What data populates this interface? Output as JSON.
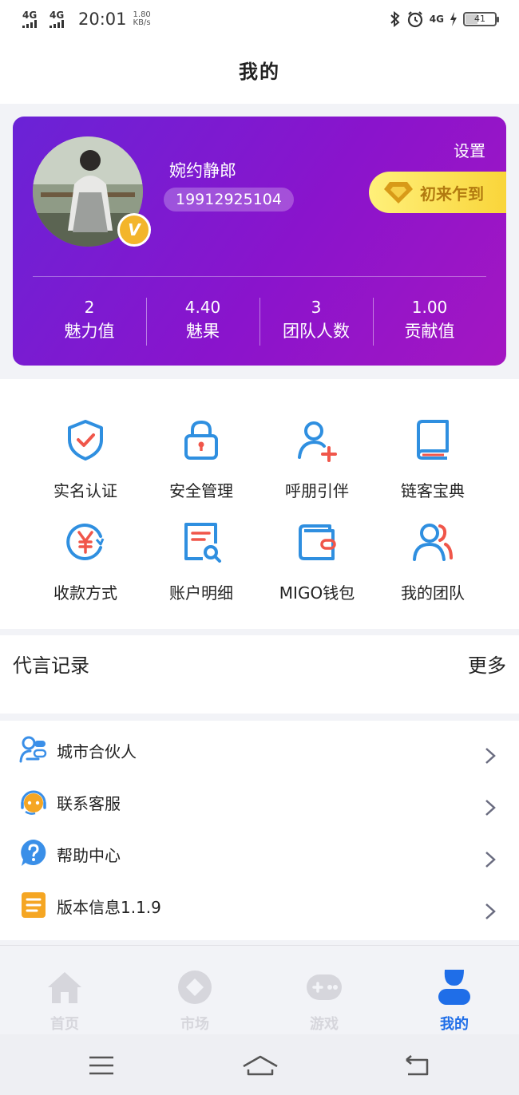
{
  "status_bar": {
    "signal1": "4G",
    "signal2": "4G",
    "time": "20:01",
    "speed_value": "1.80",
    "speed_unit": "KB/s",
    "network": "4G",
    "battery": "41"
  },
  "header": {
    "title": "我的"
  },
  "profile": {
    "username": "婉约静郎",
    "phone": "19912925104",
    "settings_label": "设置",
    "checkin_label": "初来乍到",
    "vip_badge": "V",
    "stats": [
      {
        "value": "2",
        "label": "魅力值"
      },
      {
        "value": "4.40",
        "label": "魅果"
      },
      {
        "value": "3",
        "label": "团队人数"
      },
      {
        "value": "1.00",
        "label": "贡献值"
      }
    ]
  },
  "grid_menu": [
    {
      "label": "实名认证",
      "icon": "shield-check-icon"
    },
    {
      "label": "安全管理",
      "icon": "lock-icon"
    },
    {
      "label": "呼朋引伴",
      "icon": "add-user-icon"
    },
    {
      "label": "链客宝典",
      "icon": "book-icon"
    },
    {
      "label": "收款方式",
      "icon": "yen-icon"
    },
    {
      "label": "账户明细",
      "icon": "document-search-icon"
    },
    {
      "label": "MIGO钱包",
      "icon": "wallet-icon"
    },
    {
      "label": "我的团队",
      "icon": "team-icon"
    }
  ],
  "records": {
    "title": "代言记录",
    "more": "更多"
  },
  "list": [
    {
      "label": "城市合伙人",
      "icon": "partner-icon"
    },
    {
      "label": "联系客服",
      "icon": "customer-service-icon"
    },
    {
      "label": "帮助中心",
      "icon": "help-icon"
    },
    {
      "label": "版本信息1.1.9",
      "icon": "version-icon"
    }
  ],
  "tabs": [
    {
      "label": "首页",
      "icon": "home-icon"
    },
    {
      "label": "市场",
      "icon": "market-icon"
    },
    {
      "label": "游戏",
      "icon": "game-icon"
    },
    {
      "label": "我的",
      "icon": "profile-icon",
      "active": true
    }
  ],
  "colors": {
    "accent_blue": "#2f8fe0",
    "accent_red": "#f0564a",
    "card_gradient_start": "#6a23d6",
    "card_gradient_end": "#a416c2",
    "tab_active": "#1f6ee8",
    "checkin_yellow": "#f9d53a"
  }
}
